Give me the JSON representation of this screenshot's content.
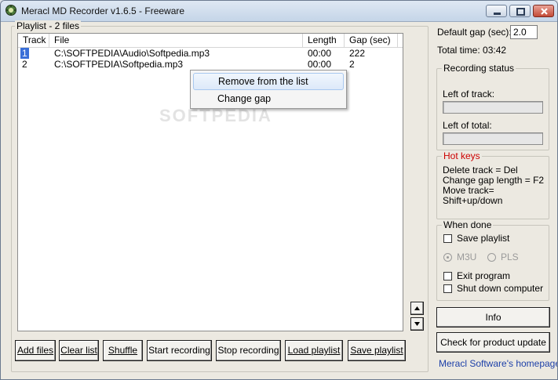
{
  "window": {
    "title": "Meracl MD Recorder v1.6.5 - Freeware",
    "controls": {
      "minimize": "minimize",
      "maximize": "maximize",
      "close": "close"
    }
  },
  "playlist": {
    "group_label": "Playlist - 2 files",
    "columns": [
      "Track",
      "File",
      "Length",
      "Gap (sec)"
    ],
    "rows": [
      {
        "track": "1",
        "file": "C:\\SOFTPEDIA\\Audio\\Softpedia.mp3",
        "length": "00:00",
        "gap": "222"
      },
      {
        "track": "2",
        "file": "C:\\SOFTPEDIA\\Softpedia.mp3",
        "length": "00:00",
        "gap": "2"
      }
    ],
    "watermark": "SOFTPEDIA"
  },
  "context_menu": {
    "items": [
      "Remove from the list",
      "Change gap"
    ]
  },
  "buttons": {
    "add_files": "Add files",
    "clear_list": "Clear list",
    "shuffle": "Shuffle",
    "start_recording": "Start recording",
    "stop_recording": "Stop recording",
    "load_playlist": "Load playlist",
    "save_playlist": "Save playlist",
    "info": "Info",
    "check_update": "Check for product update"
  },
  "settings": {
    "default_gap_label": "Default gap (sec):",
    "default_gap_value": "2.0",
    "total_time": "Total time: 03:42"
  },
  "recording_status": {
    "label": "Recording status",
    "left_of_track": "Left of track:",
    "left_of_total": "Left of total:"
  },
  "hot_keys": {
    "label": "Hot keys",
    "lines": [
      "Delete track = Del",
      "Change gap length = F2",
      "Move track=",
      "Shift+up/down"
    ],
    "label_color": "#cc0000"
  },
  "when_done": {
    "label": "When done",
    "save_playlist": "Save playlist",
    "m3u": "M3U",
    "pls": "PLS",
    "exit_program": "Exit program",
    "shut_down": "Shut down computer"
  },
  "homepage_link": "Meracl Software's homepage"
}
